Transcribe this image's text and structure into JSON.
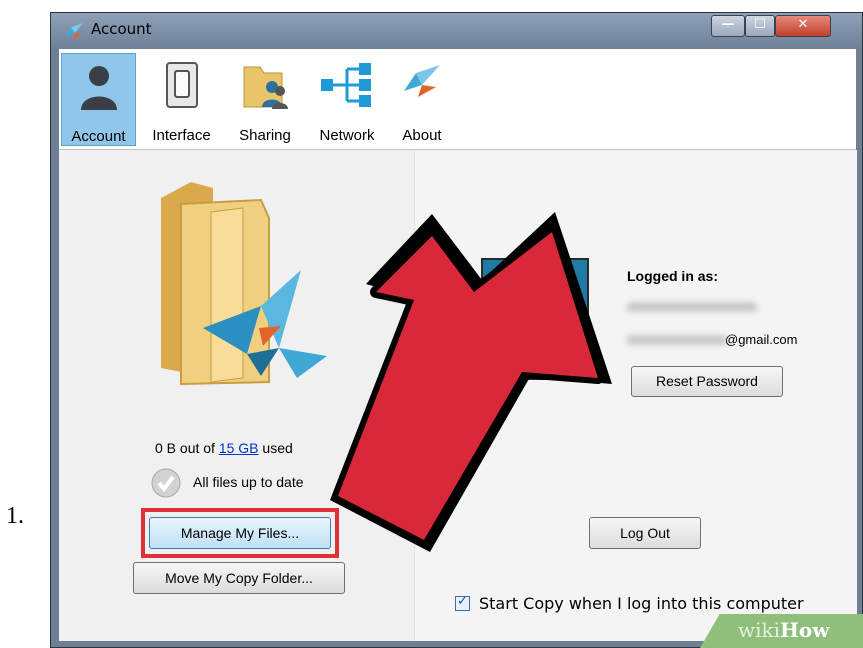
{
  "step": {
    "number": "1."
  },
  "window": {
    "title": "Account",
    "controls": {
      "minimize": "—",
      "maximize": "☐",
      "close": "✕"
    }
  },
  "toolbar": {
    "tabs": [
      {
        "label": "Account",
        "icon": "person-icon",
        "selected": true
      },
      {
        "label": "Interface",
        "icon": "switch-icon",
        "selected": false
      },
      {
        "label": "Sharing",
        "icon": "shared-folder-icon",
        "selected": false
      },
      {
        "label": "Network",
        "icon": "network-icon",
        "selected": false
      },
      {
        "label": "About",
        "icon": "copy-logo-icon",
        "selected": false
      }
    ]
  },
  "account": {
    "usage": {
      "prefix": "0 B out of ",
      "quota": "15 GB",
      "suffix": " used"
    },
    "sync_status": "All files up to date",
    "manage_button": "Manage My Files...",
    "move_button": "Move My Copy Folder...",
    "logged_in_label": "Logged in as:",
    "email_domain": "@gmail.com",
    "reset_button": "Reset Password",
    "logout_button": "Log Out",
    "start_copy": {
      "label": "Start Copy when I log into this computer",
      "checked": true
    }
  },
  "watermark": {
    "wiki": "wiki",
    "how": "How"
  },
  "colors": {
    "arrow": "#d8283a",
    "highlight": "#e0303c",
    "selected_tab": "#8fc6ea"
  }
}
